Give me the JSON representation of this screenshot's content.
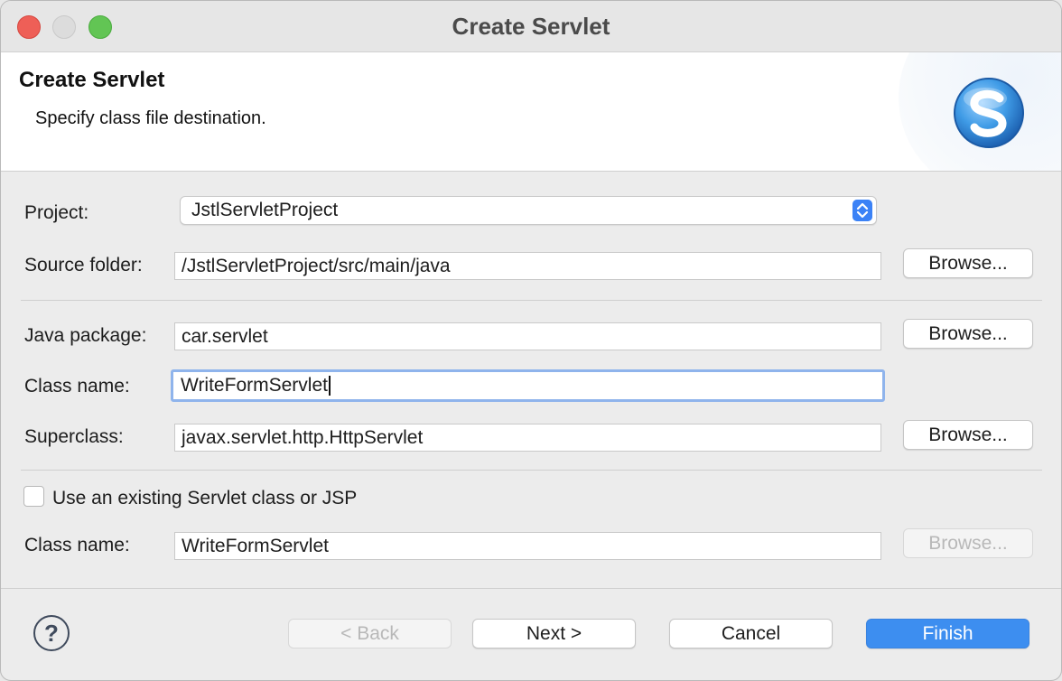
{
  "window": {
    "title": "Create Servlet"
  },
  "banner": {
    "title": "Create Servlet",
    "subtitle": "Specify class file destination.",
    "logo_icon": "servlet-s-logo-icon"
  },
  "form": {
    "project": {
      "label": "Project:",
      "value": "JstlServletProject"
    },
    "source_folder": {
      "label": "Source folder:",
      "value": "/JstlServletProject/src/main/java",
      "browse_label": "Browse..."
    },
    "java_package": {
      "label": "Java package:",
      "value": "car.servlet",
      "browse_label": "Browse..."
    },
    "class_name": {
      "label": "Class name:",
      "value": "WriteFormServlet"
    },
    "superclass": {
      "label": "Superclass:",
      "value": "javax.servlet.http.HttpServlet",
      "browse_label": "Browse..."
    },
    "use_existing": {
      "label": "Use an existing Servlet class or JSP",
      "checked": false
    },
    "existing_class_name": {
      "label": "Class name:",
      "value": "WriteFormServlet",
      "browse_label": "Browse..."
    }
  },
  "footer": {
    "help_icon": "help-icon",
    "back_label": "< Back",
    "next_label": "Next >",
    "cancel_label": "Cancel",
    "finish_label": "Finish"
  },
  "colors": {
    "primary_button": "#3d8ef0",
    "focus_ring": "#8fb4ec",
    "close": "#ee5f57",
    "zoom": "#62c554"
  }
}
